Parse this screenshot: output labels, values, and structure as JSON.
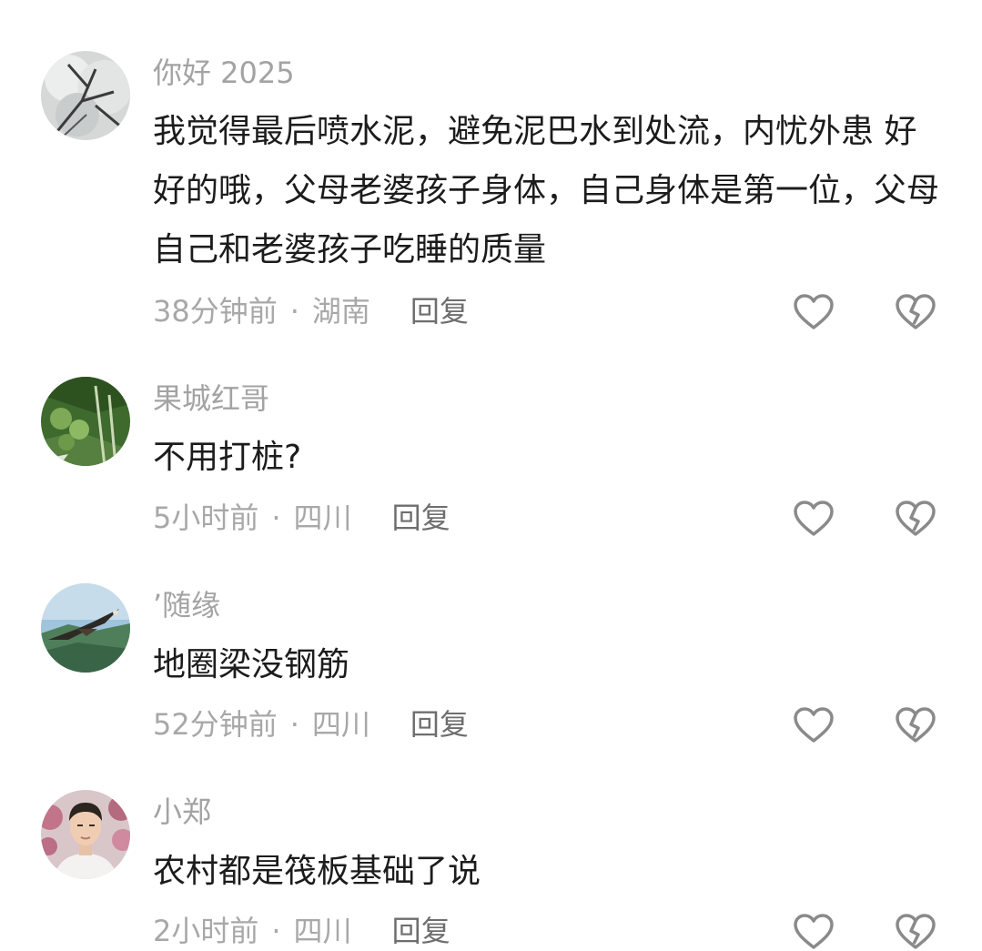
{
  "comments": [
    {
      "username": "你好 2025",
      "text": "我觉得最后喷水泥，避免泥巴水到处流，内忧外患 好好的哦，父母老婆孩子身体，自己身体是第一位，父母自己和老婆孩子吃睡的质量",
      "time": "38分钟前",
      "location": "湖南",
      "reply_label": "回复",
      "avatar_icon": "tree-branch-avatar"
    },
    {
      "username": "果城红哥",
      "text": "不用打桩?",
      "time": "5小时前",
      "location": "四川",
      "reply_label": "回复",
      "avatar_icon": "green-fruit-avatar"
    },
    {
      "username": "’随缘",
      "text": "地圈梁没钢筋",
      "time": "52分钟前",
      "location": "四川",
      "reply_label": "回复",
      "avatar_icon": "eagle-avatar"
    },
    {
      "username": "小郑",
      "text": "农村都是筏板基础了说",
      "time": "2小时前",
      "location": "四川",
      "reply_label": "回复",
      "avatar_icon": "portrait-avatar"
    }
  ],
  "separator": "·",
  "colors": {
    "username": "#a3a3a3",
    "text": "#1c1c1c",
    "meta": "#a8a8a8",
    "reply": "#6e6e6e",
    "icon": "#8a8a8a"
  }
}
